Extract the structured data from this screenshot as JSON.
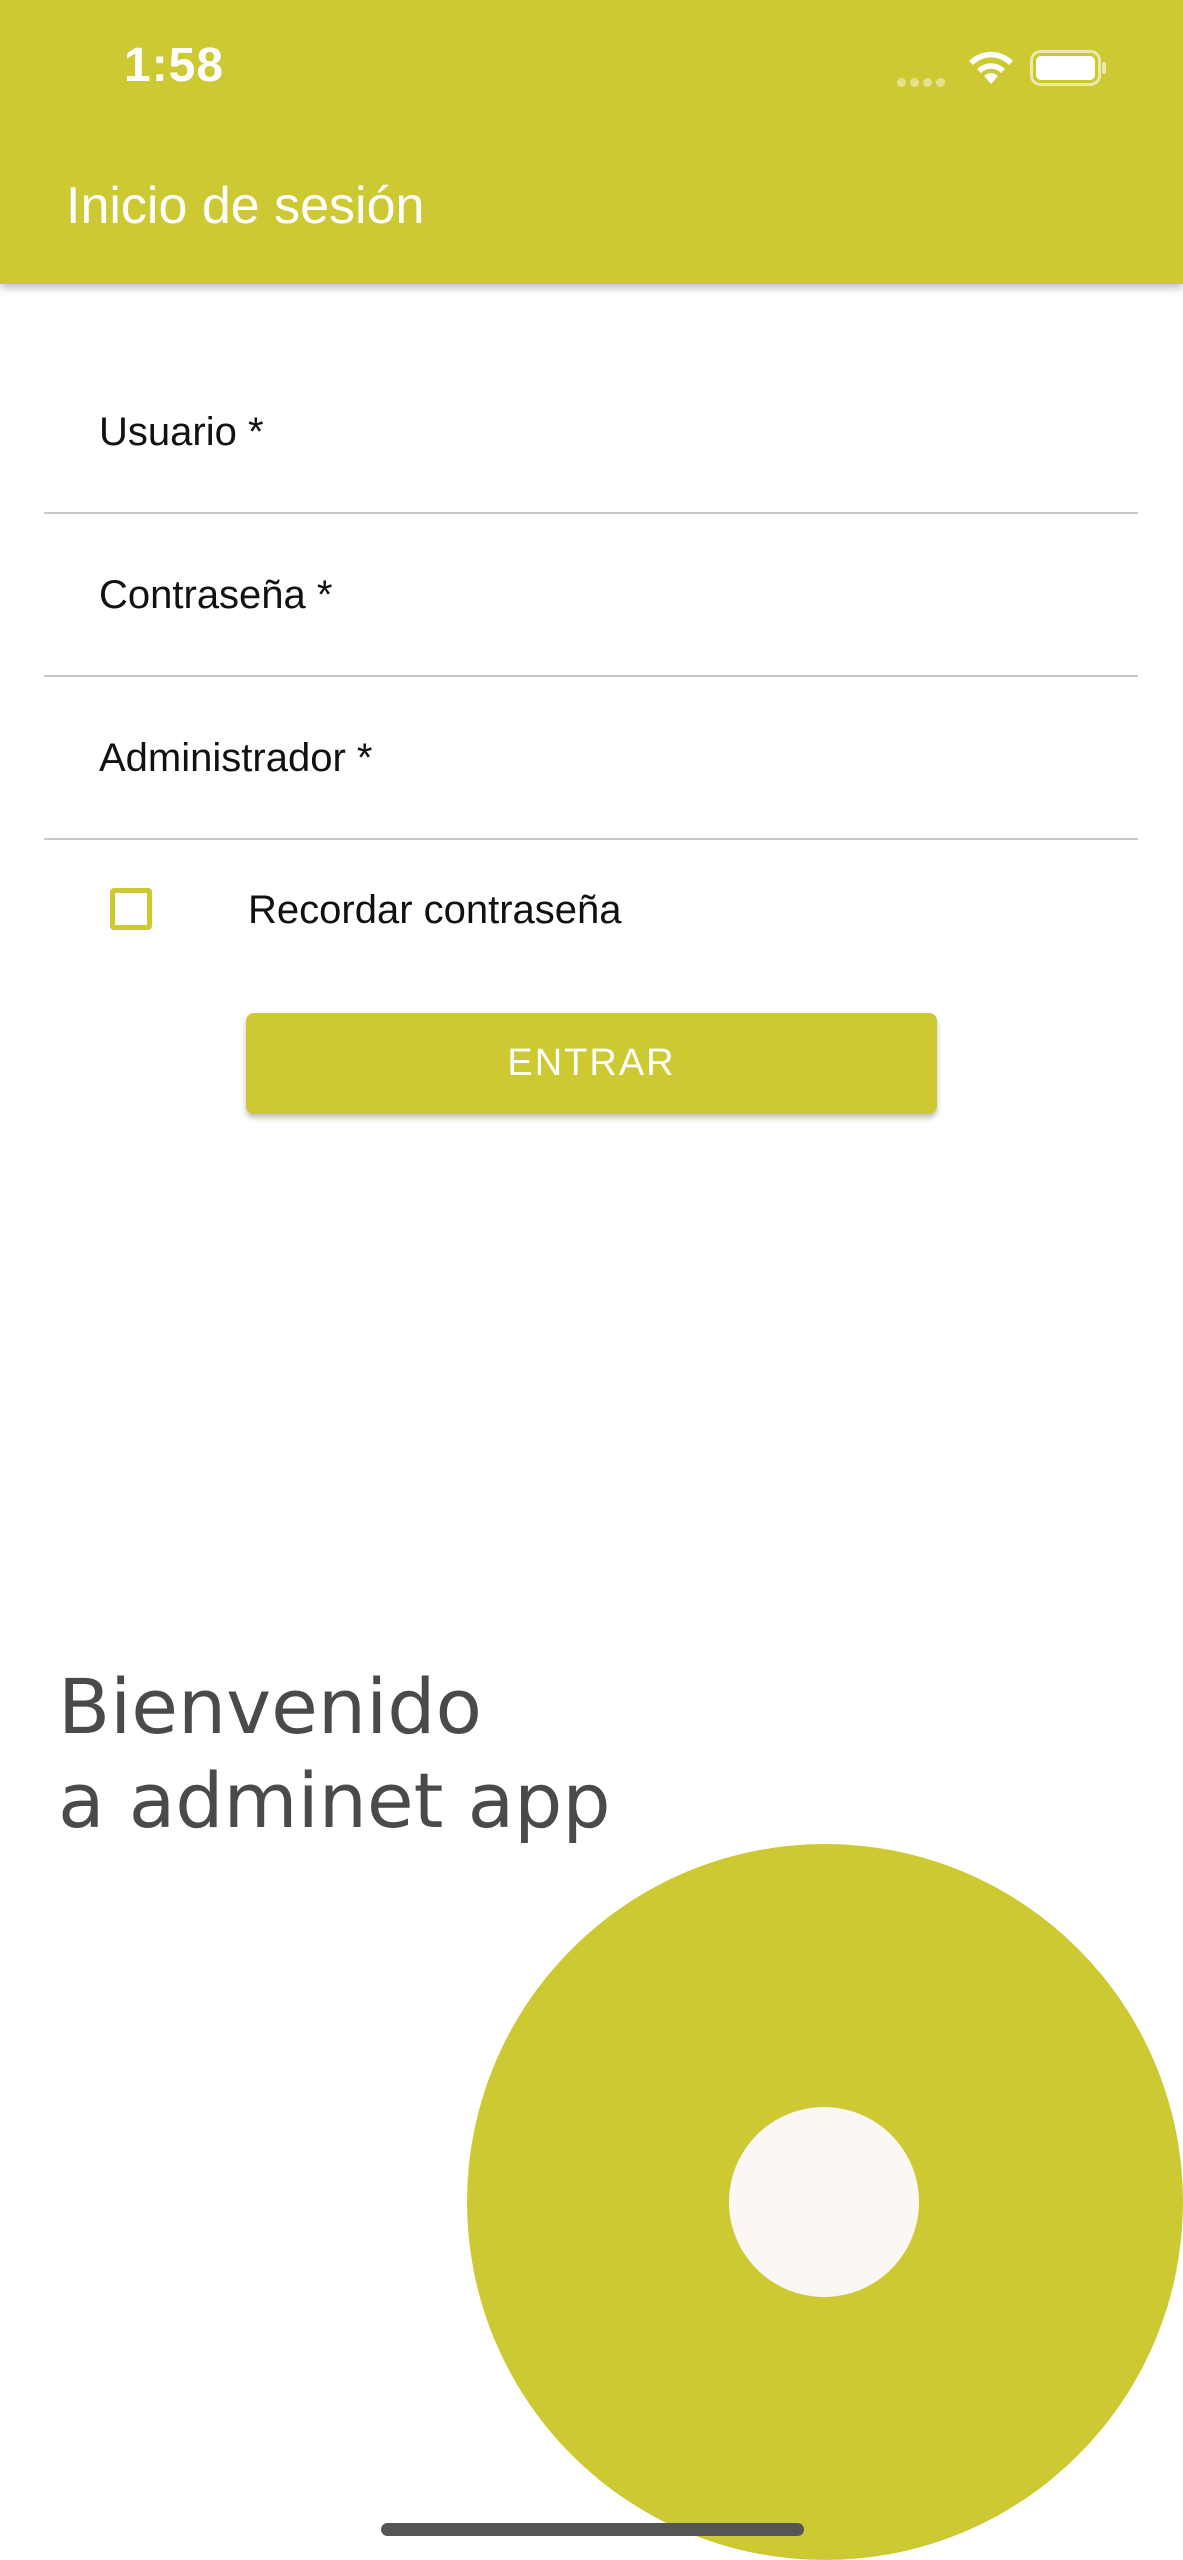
{
  "status_bar": {
    "time": "1:58",
    "wifi_icon": "wifi-icon",
    "battery_icon": "battery-icon"
  },
  "header": {
    "title": "Inicio de sesión"
  },
  "form": {
    "fields": [
      {
        "label": "Usuario *",
        "value": ""
      },
      {
        "label": "Contraseña *",
        "value": ""
      },
      {
        "label": "Administrador *",
        "value": ""
      }
    ],
    "remember": {
      "label": "Recordar contraseña",
      "checked": false
    },
    "submit_label": "ENTRAR"
  },
  "welcome": {
    "line1": "Bienvenido",
    "line2": "a adminet app"
  },
  "colors": {
    "accent": "#cdc932",
    "text": "#111111",
    "welcome_text": "#4a4a4a"
  }
}
